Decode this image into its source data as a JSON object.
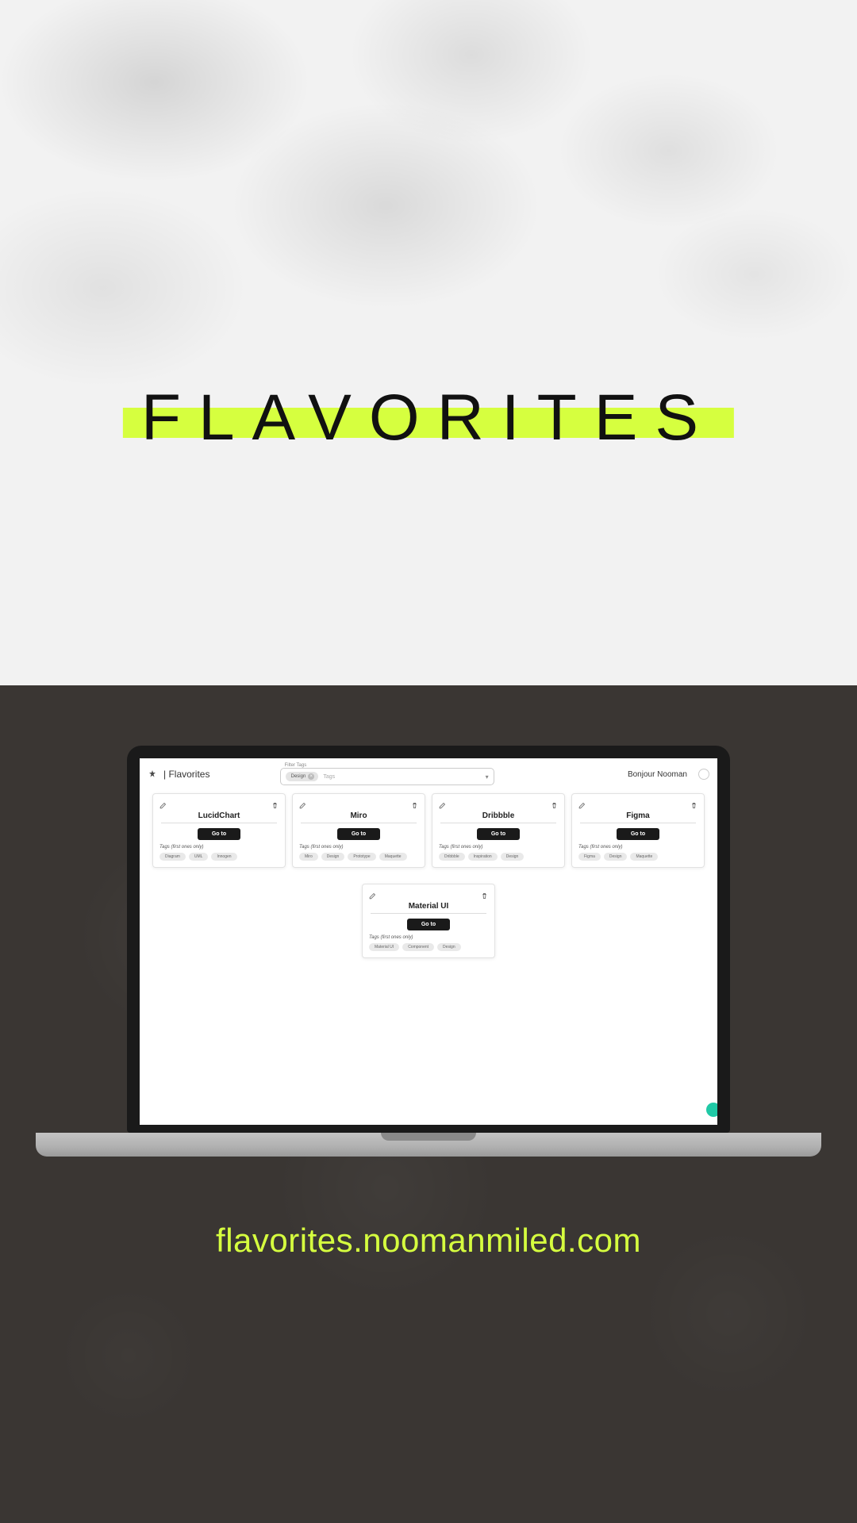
{
  "hero": {
    "title": "FLAVORITES"
  },
  "footer": {
    "url": "flavorites.noomanmiled.com"
  },
  "app": {
    "brand": "| Flavorites",
    "filter_label": "Filter Tags",
    "filter_chip": "Design",
    "filter_placeholder": "Tags",
    "greeting": "Bonjour Nooman",
    "go_label": "Go to",
    "tags_label": "Tags (first ones only)",
    "cards": [
      {
        "title": "LucidChart",
        "tags": [
          "Diagram",
          "UML",
          "Innogen"
        ]
      },
      {
        "title": "Miro",
        "tags": [
          "Miro",
          "Design",
          "Prototype",
          "Maquette"
        ]
      },
      {
        "title": "Dribbble",
        "tags": [
          "Dribbble",
          "Inspiration",
          "Design"
        ]
      },
      {
        "title": "Figma",
        "tags": [
          "Figma",
          "Design",
          "Maquette"
        ]
      },
      {
        "title": "Material UI",
        "tags": [
          "Material UI",
          "Component",
          "Design"
        ]
      }
    ]
  },
  "colors": {
    "highlight": "#d6ff3f",
    "dark": "#3a3633",
    "fab": "#20c9a6"
  }
}
